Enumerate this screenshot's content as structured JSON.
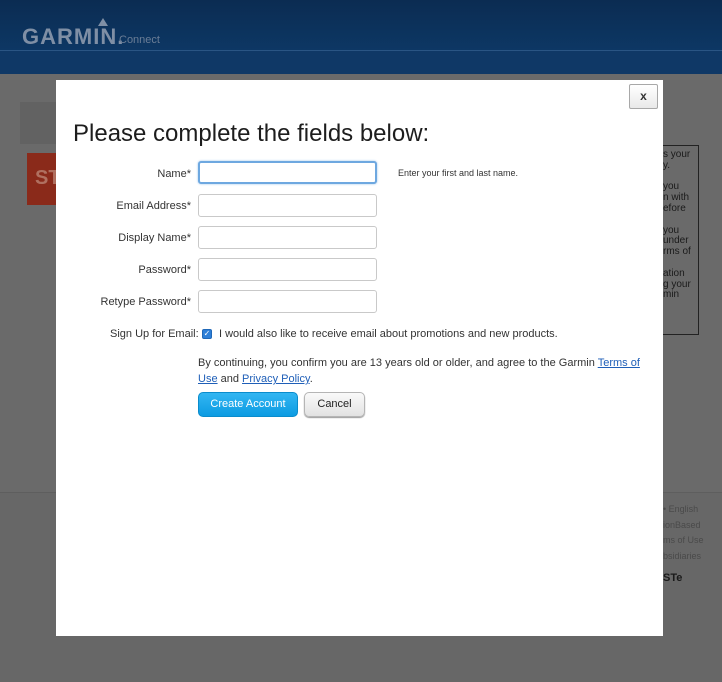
{
  "header": {
    "logo_text": "GARMIN.",
    "logo_sub": "Connect"
  },
  "background": {
    "promo_fragment": "ST",
    "side_text": "s your\ny.\n\nyou\nn with\nefore\n\nyou\nunder\nrms of\n\nation\ng your\nmin",
    "footer_links": "• English\nionBased\nms of Use\nbsidiaries",
    "footer_brand": "STe"
  },
  "modal": {
    "close_label": "x",
    "title": "Please complete the fields below:",
    "fields": [
      {
        "label": "Name*",
        "value": "",
        "hint": "Enter your first and last name."
      },
      {
        "label": "Email Address*",
        "value": ""
      },
      {
        "label": "Display Name*",
        "value": ""
      },
      {
        "label": "Password*",
        "value": ""
      },
      {
        "label": "Retype Password*",
        "value": ""
      }
    ],
    "email_signup": {
      "label": "Sign Up for Email:",
      "checked": true,
      "checkbox_text": "I would also like to receive email about promotions and new products."
    },
    "legal": {
      "text_before": "By continuing, you confirm you are 13 years old or older, and agree to the Garmin ",
      "terms_link": "Terms of Use",
      "text_and": " and ",
      "privacy_link": "Privacy Policy",
      "text_after": "."
    },
    "buttons": {
      "create": "Create Account",
      "cancel": "Cancel"
    }
  },
  "colors": {
    "header_bg": "#0d3764",
    "primary_button": "#19a7ea",
    "link": "#1f5fb8",
    "focus_border": "#6ea8e0"
  }
}
